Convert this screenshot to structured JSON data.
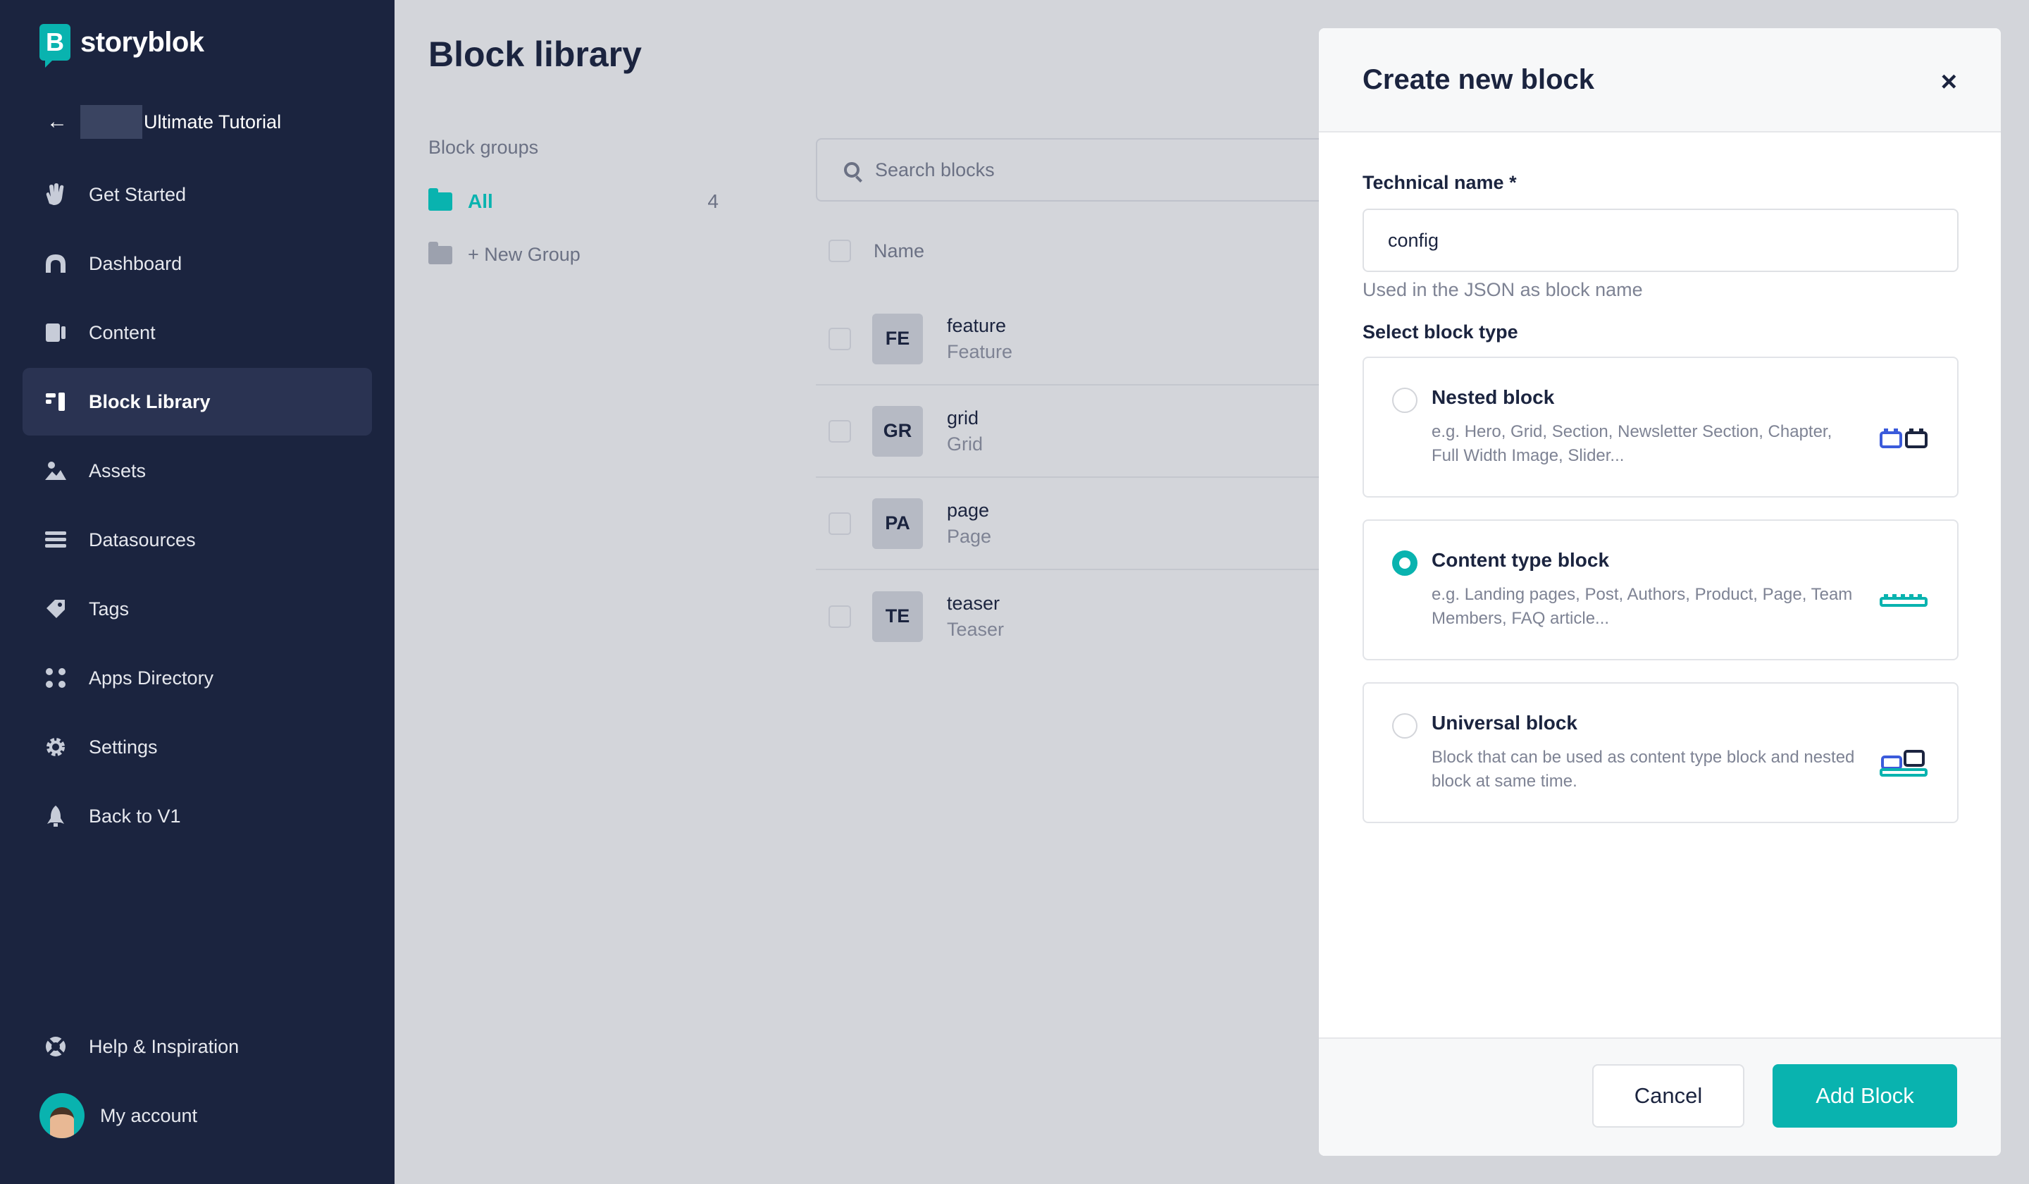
{
  "brand": {
    "name": "storyblok",
    "logo_letter": "B",
    "accent": "#09b3af",
    "sidebar_bg": "#1b243f"
  },
  "space": {
    "name": "Ultimate Tutorial"
  },
  "sidebar": {
    "items": [
      {
        "label": "Get Started",
        "icon": "wave-hand-icon"
      },
      {
        "label": "Dashboard",
        "icon": "dashboard-icon"
      },
      {
        "label": "Content",
        "icon": "content-icon"
      },
      {
        "label": "Block Library",
        "icon": "block-library-icon",
        "active": true
      },
      {
        "label": "Assets",
        "icon": "assets-icon"
      },
      {
        "label": "Datasources",
        "icon": "datasources-icon"
      },
      {
        "label": "Tags",
        "icon": "tags-icon"
      },
      {
        "label": "Apps Directory",
        "icon": "apps-icon"
      },
      {
        "label": "Settings",
        "icon": "gear-icon"
      },
      {
        "label": "Back to V1",
        "icon": "rocket-icon"
      }
    ],
    "help": "Help & Inspiration",
    "account": "My account"
  },
  "page": {
    "title": "Block library",
    "groups_label": "Block groups",
    "group_all": "All",
    "group_all_count": "4",
    "new_group": "+ New Group",
    "search_placeholder": "Search blocks",
    "column_name": "Name"
  },
  "blocks": [
    {
      "badge": "FE",
      "name": "feature",
      "display": "Feature"
    },
    {
      "badge": "GR",
      "name": "grid",
      "display": "Grid"
    },
    {
      "badge": "PA",
      "name": "page",
      "display": "Page"
    },
    {
      "badge": "TE",
      "name": "teaser",
      "display": "Teaser"
    }
  ],
  "modal": {
    "title": "Create new block",
    "close": "×",
    "technical_name_label": "Technical name *",
    "technical_name_value": "config",
    "hint": "Used in the JSON as block name",
    "block_type_label": "Select block type",
    "types": [
      {
        "title": "Nested block",
        "desc": "e.g. Hero, Grid, Section, Newsletter Section, Chapter, Full Width Image, Slider...",
        "icon": "nested-block-icon",
        "checked": false
      },
      {
        "title": "Content type block",
        "desc": "e.g. Landing pages, Post, Authors, Product, Page, Team Members, FAQ article...",
        "icon": "content-type-block-icon",
        "checked": true
      },
      {
        "title": "Universal block",
        "desc": "Block that can be used as content type block and nested block at same time.",
        "icon": "universal-block-icon",
        "checked": false
      }
    ],
    "cancel": "Cancel",
    "add": "Add Block"
  }
}
